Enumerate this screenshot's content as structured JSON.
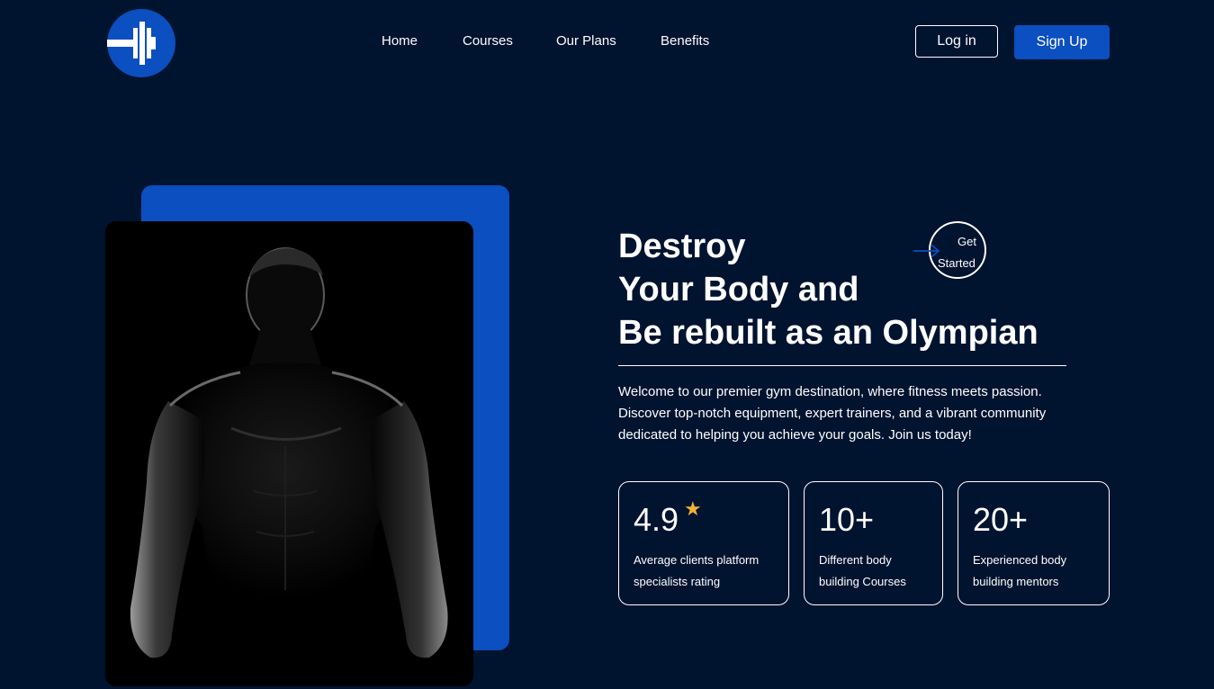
{
  "brand": {
    "logo_icon": "dumbbell-icon",
    "logo_color": "#0b4fc0"
  },
  "nav": {
    "items": [
      {
        "label": "Home"
      },
      {
        "label": "Courses"
      },
      {
        "label": "Our Plans"
      },
      {
        "label": "Benefits"
      }
    ]
  },
  "header": {
    "login_label": "Log in",
    "signup_label": "Sign Up"
  },
  "hero": {
    "headline_lines": [
      "Destroy",
      "Your Body and",
      "Be rebuilt as an Olympian"
    ],
    "cta": {
      "line1": "Get",
      "line2": "Started",
      "icon": "arrow-right-icon"
    },
    "description": "Welcome to our premier gym destination, where fitness meets passion. Discover top-notch equipment, expert trainers, and a vibrant community dedicated to helping you achieve your goals. Join us today!",
    "image_subject": "muscular-man-silhouette"
  },
  "stats": [
    {
      "value": "4.9",
      "icon": "star-icon",
      "label_lines": [
        "Average clients platform",
        "specialists rating"
      ]
    },
    {
      "value": "10+",
      "label_lines": [
        "Different body",
        "building Courses"
      ]
    },
    {
      "value": "20+",
      "label_lines": [
        "Experienced body",
        "building mentors"
      ]
    }
  ],
  "colors": {
    "background": "#00132f",
    "accent": "#0b4fc0",
    "star": "#f2b233",
    "text": "#ffffff"
  }
}
